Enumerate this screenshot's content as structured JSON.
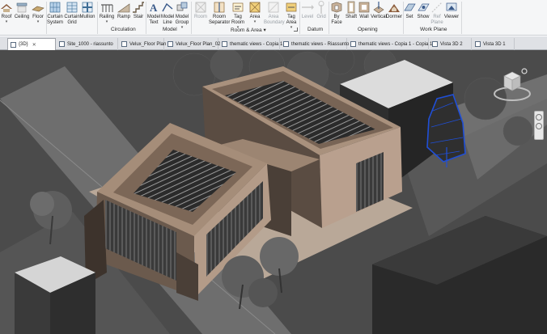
{
  "ribbon": {
    "tools": [
      {
        "id": "roof",
        "label": "Roof",
        "icon": "roof-icon"
      },
      {
        "id": "ceiling",
        "label": "Ceiling",
        "icon": "ceiling-icon"
      },
      {
        "id": "floor",
        "label": "Floor",
        "icon": "floor-icon"
      },
      {
        "id": "curtain-system",
        "label": "Curtain System",
        "icon": "curtain-system-icon"
      },
      {
        "id": "curtain-grid",
        "label": "Curtain Grid",
        "icon": "curtain-grid-icon"
      },
      {
        "id": "mullion",
        "label": "Mullion",
        "icon": "mullion-icon"
      },
      {
        "id": "railing",
        "label": "Railing",
        "icon": "railing-icon"
      },
      {
        "id": "ramp",
        "label": "Ramp",
        "icon": "ramp-icon"
      },
      {
        "id": "stair",
        "label": "Stair",
        "icon": "stair-icon"
      },
      {
        "id": "model-text",
        "label": "Model Text",
        "icon": "model-text-icon"
      },
      {
        "id": "model-line",
        "label": "Model Line",
        "icon": "model-line-icon"
      },
      {
        "id": "model-group",
        "label": "Model Group",
        "icon": "model-group-icon"
      },
      {
        "id": "room",
        "label": "Room",
        "icon": "room-icon",
        "disabled": true
      },
      {
        "id": "room-separator",
        "label": "Room Separator",
        "icon": "room-separator-icon"
      },
      {
        "id": "tag-room",
        "label": "Tag Room",
        "icon": "tag-room-icon"
      },
      {
        "id": "area",
        "label": "Area",
        "icon": "area-icon"
      },
      {
        "id": "area-boundary",
        "label": "Area Boundary",
        "icon": "area-boundary-icon",
        "disabled": true
      },
      {
        "id": "tag-area",
        "label": "Tag Area",
        "icon": "tag-area-icon"
      },
      {
        "id": "level",
        "label": "Level",
        "icon": "level-icon",
        "disabled": true
      },
      {
        "id": "grid",
        "label": "Grid",
        "icon": "grid-icon",
        "disabled": true
      },
      {
        "id": "by-face",
        "label": "By Face",
        "icon": "by-face-icon"
      },
      {
        "id": "shaft",
        "label": "Shaft",
        "icon": "shaft-icon"
      },
      {
        "id": "wall",
        "label": "Wall",
        "icon": "wall-opening-icon"
      },
      {
        "id": "vertical",
        "label": "Vertical",
        "icon": "vertical-opening-icon"
      },
      {
        "id": "dormer",
        "label": "Dormer",
        "icon": "dormer-icon"
      },
      {
        "id": "set",
        "label": "Set",
        "icon": "set-icon"
      },
      {
        "id": "show",
        "label": "Show",
        "icon": "show-icon"
      },
      {
        "id": "ref-plane",
        "label": "Ref Plane",
        "icon": "ref-plane-icon",
        "disabled": true
      },
      {
        "id": "viewer",
        "label": "Viewer",
        "icon": "viewer-icon"
      }
    ],
    "panels": [
      {
        "id": "circulation",
        "label": "Circulation"
      },
      {
        "id": "model",
        "label": "Model"
      },
      {
        "id": "room-area",
        "label": "Room & Area ▾"
      },
      {
        "id": "datum",
        "label": "Datum"
      },
      {
        "id": "opening",
        "label": "Opening"
      },
      {
        "id": "work-plane",
        "label": "Work Plane"
      }
    ]
  },
  "tabs": [
    {
      "label": "{3D}",
      "active": true
    },
    {
      "label": "Site_1000 - riassunto",
      "active": false
    },
    {
      "label": "Velux_Floor Plan",
      "active": false
    },
    {
      "label": "Velux_Floor Plan_02",
      "active": false
    },
    {
      "label": "thematic views - Copia 1",
      "active": false
    },
    {
      "label": "thematic views - Riassunto",
      "active": false
    },
    {
      "label": "thematic views - Copia 1 - Copia 1...",
      "active": false
    },
    {
      "label": "Vista 3D 2",
      "active": false
    },
    {
      "label": "Vista 3D 1",
      "active": false
    }
  ],
  "tab_close_glyph": "✕",
  "colors": {
    "viewport_bg": "#4b4b4b",
    "road": "#6e6e6e",
    "facade": "#b7a08f",
    "facade_shadow": "#51463e",
    "selection": "#1f4fd8"
  }
}
